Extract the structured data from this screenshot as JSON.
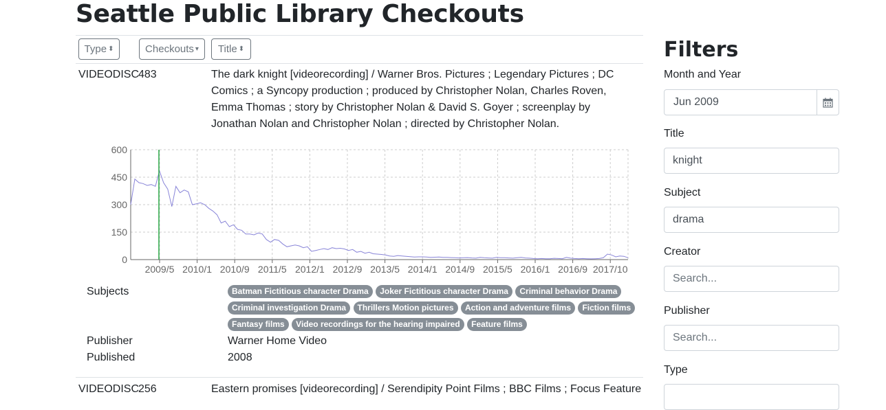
{
  "page": {
    "title": "Seattle Public Library Checkouts"
  },
  "sort_buttons": [
    {
      "label": "Type",
      "icon": "sort-icon"
    },
    {
      "label": "Checkouts",
      "icon": "sort-down-icon"
    },
    {
      "label": "Title",
      "icon": "sort-icon"
    }
  ],
  "items": [
    {
      "type": "VIDEODISC",
      "checkouts": "483",
      "title": "The dark knight [videorecording] / Warner Bros. Pictures ; Legendary Pictures ; DC Comics ; a Syncopy production ; produced by Christopher Nolan, Charles Roven, Emma Thomas ; story by Christopher Nolan & David S. Goyer ; screenplay by Jonathan Nolan and Christopher Nolan ; directed by Christopher Nolan.",
      "subjects_label": "Subjects",
      "subjects": [
        "Batman Fictitious character Drama",
        "Joker Fictitious character Drama",
        "Criminal behavior Drama",
        "Criminal investigation Drama",
        "Thrillers Motion pictures",
        "Action and adventure films",
        "Fiction films",
        "Fantasy films",
        "Video recordings for the hearing impaired",
        "Feature films"
      ],
      "publisher_label": "Publisher",
      "publisher": "Warner Home Video",
      "published_label": "Published",
      "published": "2008"
    },
    {
      "type": "VIDEODISC",
      "checkouts": "256",
      "title": "Eastern promises [videorecording] / Serendipity Point Films ; BBC Films ; Focus Features ;"
    }
  ],
  "chart_data": {
    "type": "line",
    "yticks": [
      "0",
      "150",
      "300",
      "450",
      "600"
    ],
    "xticks": [
      "2009/5",
      "2010/1",
      "2010/9",
      "2011/5",
      "2012/1",
      "2012/9",
      "2013/5",
      "2014/1",
      "2014/9",
      "2015/5",
      "2016/1",
      "2016/9",
      "2017/10"
    ],
    "ylim": [
      0,
      600
    ],
    "grid": true,
    "line_color": "#8884d8",
    "marker_color": "#28a745",
    "marker_x": "2009/6",
    "series": [
      {
        "values": [
          [
            0,
            300
          ],
          [
            1,
            440
          ],
          [
            2,
            420
          ],
          [
            3,
            415
          ],
          [
            4,
            405
          ],
          [
            5,
            410
          ],
          [
            6,
            400
          ],
          [
            7,
            485
          ],
          [
            8,
            420
          ],
          [
            9,
            385
          ],
          [
            10,
            290
          ],
          [
            11,
            400
          ],
          [
            12,
            365
          ],
          [
            13,
            380
          ],
          [
            14,
            370
          ],
          [
            15,
            300
          ],
          [
            16,
            305
          ],
          [
            17,
            310
          ],
          [
            18,
            300
          ],
          [
            19,
            280
          ],
          [
            20,
            265
          ],
          [
            21,
            245
          ],
          [
            22,
            200
          ],
          [
            23,
            210
          ],
          [
            24,
            180
          ],
          [
            25,
            190
          ],
          [
            26,
            165
          ],
          [
            27,
            160
          ],
          [
            28,
            140
          ],
          [
            29,
            140
          ],
          [
            30,
            135
          ],
          [
            31,
            145
          ],
          [
            32,
            140
          ],
          [
            33,
            110
          ],
          [
            34,
            95
          ],
          [
            35,
            110
          ],
          [
            36,
            105
          ],
          [
            37,
            85
          ],
          [
            38,
            70
          ],
          [
            39,
            75
          ],
          [
            40,
            80
          ],
          [
            41,
            75
          ],
          [
            42,
            65
          ],
          [
            43,
            70
          ],
          [
            44,
            45
          ],
          [
            45,
            50
          ],
          [
            46,
            55
          ],
          [
            47,
            60
          ],
          [
            48,
            55
          ],
          [
            49,
            65
          ],
          [
            50,
            60
          ],
          [
            51,
            62
          ],
          [
            52,
            58
          ],
          [
            53,
            50
          ],
          [
            54,
            55
          ],
          [
            55,
            40
          ],
          [
            56,
            45
          ],
          [
            57,
            35
          ],
          [
            58,
            40
          ],
          [
            59,
            32
          ],
          [
            60,
            30
          ],
          [
            61,
            28
          ],
          [
            62,
            25
          ],
          [
            63,
            20
          ],
          [
            64,
            18
          ],
          [
            65,
            22
          ],
          [
            66,
            20
          ],
          [
            67,
            18
          ],
          [
            68,
            16
          ],
          [
            69,
            14
          ],
          [
            70,
            15
          ],
          [
            71,
            15
          ],
          [
            72,
            14
          ],
          [
            73,
            12
          ],
          [
            74,
            13
          ],
          [
            75,
            14
          ],
          [
            76,
            12
          ],
          [
            77,
            12
          ],
          [
            78,
            11
          ],
          [
            79,
            10
          ],
          [
            80,
            9
          ],
          [
            81,
            10
          ],
          [
            82,
            11
          ],
          [
            83,
            9
          ],
          [
            84,
            8
          ],
          [
            85,
            12
          ],
          [
            86,
            10
          ],
          [
            87,
            9
          ],
          [
            88,
            8
          ],
          [
            89,
            12
          ],
          [
            90,
            10
          ],
          [
            91,
            10
          ],
          [
            92,
            9
          ],
          [
            93,
            8
          ],
          [
            94,
            10
          ],
          [
            95,
            12
          ],
          [
            96,
            9
          ],
          [
            97,
            8
          ],
          [
            98,
            6
          ],
          [
            99,
            5
          ],
          [
            100,
            6
          ],
          [
            101,
            5
          ],
          [
            102,
            5
          ],
          [
            103,
            7
          ],
          [
            104,
            6
          ],
          [
            105,
            5
          ],
          [
            106,
            12
          ],
          [
            107,
            8
          ],
          [
            108,
            6
          ],
          [
            109,
            5
          ],
          [
            110,
            6
          ],
          [
            111,
            5
          ],
          [
            112,
            4
          ],
          [
            113,
            5
          ],
          [
            114,
            6
          ],
          [
            115,
            10
          ],
          [
            116,
            30
          ],
          [
            117,
            25
          ],
          [
            118,
            15
          ],
          [
            119,
            20
          ],
          [
            120,
            18
          ],
          [
            121,
            10
          ]
        ]
      }
    ]
  },
  "filters": {
    "title": "Filters",
    "month_year": {
      "label": "Month and Year",
      "value": "Jun 2009"
    },
    "title_filter": {
      "label": "Title",
      "value": "knight"
    },
    "subject": {
      "label": "Subject",
      "value": "drama"
    },
    "creator": {
      "label": "Creator",
      "placeholder": "Search..."
    },
    "publisher": {
      "label": "Publisher",
      "placeholder": "Search..."
    },
    "type": {
      "label": "Type"
    }
  }
}
